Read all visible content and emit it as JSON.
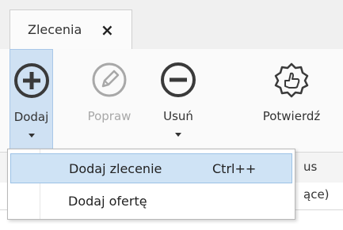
{
  "tab": {
    "label": "Zlecenia",
    "close": "×"
  },
  "ribbon": {
    "add": {
      "label": "Dodaj",
      "icon": "plus-circle-icon"
    },
    "edit": {
      "label": "Popraw",
      "icon": "pencil-circle-icon"
    },
    "remove": {
      "label": "Usuń",
      "icon": "minus-circle-icon"
    },
    "confirm": {
      "label": "Potwierdź",
      "icon": "thumbs-up-badge-icon"
    }
  },
  "grid": {
    "header_fragment": "us",
    "row_fragment": "ące)"
  },
  "dropdown": {
    "items": [
      {
        "label": "Dodaj zlecenie",
        "shortcut": "Ctrl++"
      },
      {
        "label": "Dodaj ofertę",
        "shortcut": ""
      }
    ]
  },
  "colors": {
    "hover_bg": "#cfe3f5",
    "active_button_bg": "#cfe1f3",
    "icon_dark": "#3a3a3a",
    "icon_disabled": "#a8a8a8"
  }
}
